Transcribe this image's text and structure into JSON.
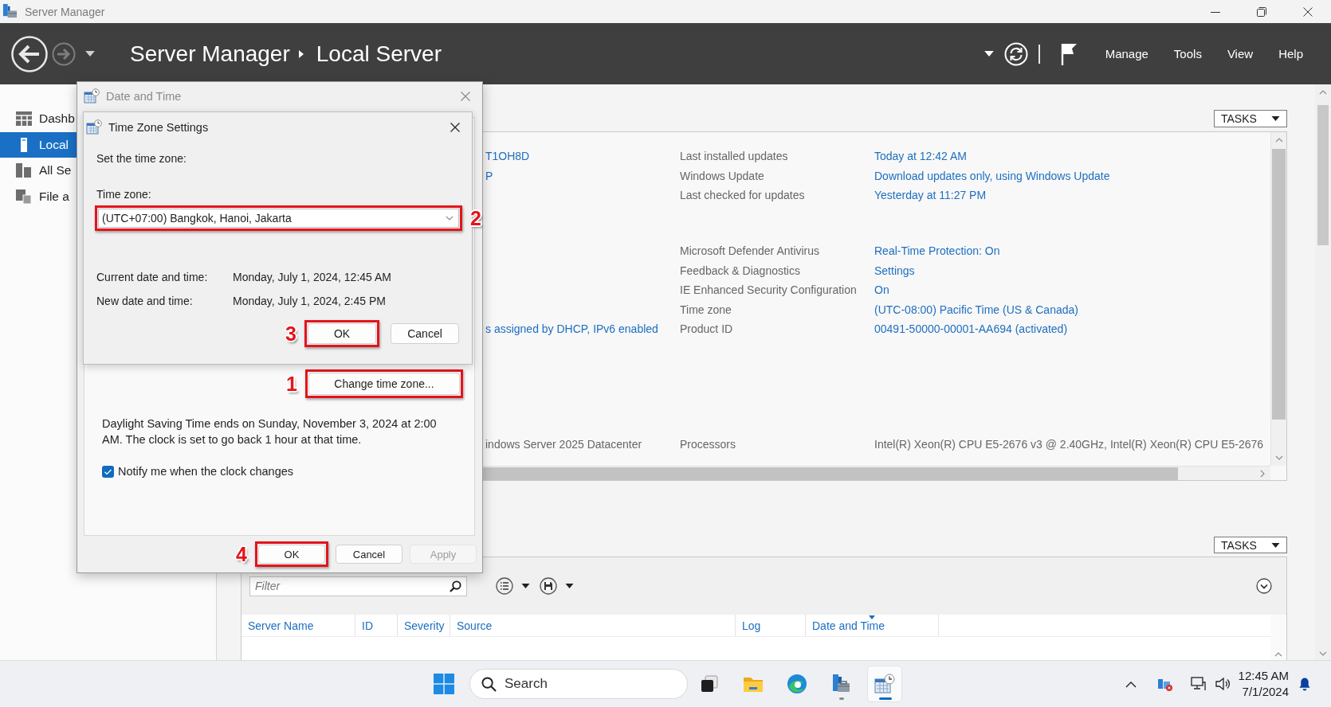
{
  "title_bar": {
    "title": "Server Manager"
  },
  "header": {
    "breadcrumb": [
      "Server Manager",
      "Local Server"
    ],
    "menu": [
      "Manage",
      "Tools",
      "View",
      "Help"
    ]
  },
  "sidebar": {
    "items": [
      {
        "label": "Dashb",
        "selected": false
      },
      {
        "label": "Local",
        "selected": true
      },
      {
        "label": "All Se",
        "selected": false
      },
      {
        "label": "File a",
        "selected": false
      }
    ]
  },
  "properties": {
    "tasks_button": "TASKS",
    "groups": [
      {
        "rows": [
          {
            "left": {
              "text": "T1OH8D",
              "link": true
            },
            "label": "Last installed updates",
            "value": {
              "text": "Today at 12:42 AM",
              "link": true
            }
          },
          {
            "left": {
              "text": "P",
              "link": true
            },
            "label": "Windows Update",
            "value": {
              "text": "Download updates only, using Windows Update",
              "link": true
            }
          },
          {
            "label": "Last checked for updates",
            "value": {
              "text": "Yesterday at 11:27 PM",
              "link": true
            }
          }
        ]
      },
      {
        "rows": [
          {
            "label": "Microsoft Defender Antivirus",
            "value": {
              "text": "Real-Time Protection: On",
              "link": true
            }
          },
          {
            "label": "Feedback & Diagnostics",
            "value": {
              "text": "Settings",
              "link": true
            }
          },
          {
            "label": "IE Enhanced Security Configuration",
            "value": {
              "text": "On",
              "link": true
            }
          },
          {
            "label": "Time zone",
            "value": {
              "text": "(UTC-08:00) Pacific Time (US & Canada)",
              "link": true
            }
          },
          {
            "left": {
              "text": "s assigned by DHCP, IPv6 enabled",
              "link": true
            },
            "label": "Product ID",
            "value": {
              "text": "00491-50000-00001-AA694 (activated)",
              "link": true
            }
          }
        ]
      },
      {
        "rows": [
          {
            "left": {
              "text": "indows Server 2025 Datacenter",
              "link": false
            },
            "label": "Processors",
            "value": {
              "text": "Intel(R) Xeon(R) CPU E5-2676 v3 @ 2.40GHz, Intel(R) Xeon(R) CPU E5-2676",
              "link": false
            }
          }
        ]
      }
    ]
  },
  "events": {
    "tasks_button": "TASKS",
    "filter": {
      "placeholder": "Filter"
    },
    "columns": [
      {
        "label": "Server Name",
        "sorted": false
      },
      {
        "label": "ID",
        "sorted": false
      },
      {
        "label": "Severity",
        "sorted": false
      },
      {
        "label": "Source",
        "sorted": false
      },
      {
        "label": "Log",
        "sorted": false
      },
      {
        "label": "Date and Time",
        "sorted": true
      }
    ]
  },
  "date_time_dialog": {
    "title": "Date and Time",
    "active": false,
    "change_button": {
      "label": "Change time zone...",
      "callout": "1"
    },
    "dst_note": "Daylight Saving Time ends on Sunday, November 3, 2024 at 2:00 AM. The clock is set to go back 1 hour at that time.",
    "notify_checkbox": {
      "label": "Notify me when the clock changes",
      "checked": true
    },
    "buttons": [
      {
        "label": "OK",
        "callout": "4",
        "disabled": false
      },
      {
        "label": "Cancel",
        "disabled": false
      },
      {
        "label": "Apply",
        "disabled": true
      }
    ]
  },
  "time_zone_dialog": {
    "title": "Time Zone Settings",
    "active": true,
    "prompt": "Set the time zone:",
    "field_label": "Time zone:",
    "time_zone": {
      "value": "(UTC+07:00) Bangkok, Hanoi, Jakarta",
      "callout": "2"
    },
    "info": [
      {
        "label": "Current date and time:",
        "value": "Monday, July 1, 2024, 12:45 AM"
      },
      {
        "label": "New date and time:",
        "value": "Monday, July 1, 2024, 2:45 PM"
      }
    ],
    "buttons": [
      {
        "label": "OK",
        "callout": "3",
        "disabled": false
      },
      {
        "label": "Cancel",
        "disabled": false
      }
    ]
  },
  "taskbar": {
    "search": {
      "placeholder": "Search"
    },
    "apps": [
      {
        "running": false,
        "selected": false
      },
      {
        "running": false,
        "selected": false
      },
      {
        "running": false,
        "selected": false
      },
      {
        "running": true,
        "selected": false
      },
      {
        "running": true,
        "selected": true
      }
    ],
    "clock": {
      "time": "12:45 AM",
      "date": "7/1/2024"
    }
  }
}
